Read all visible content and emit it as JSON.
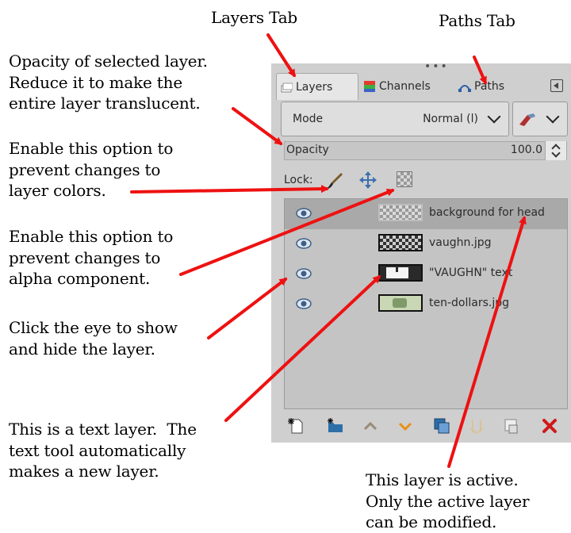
{
  "annotations": {
    "layers_tab": "Layers Tab",
    "paths_tab": "Paths Tab",
    "opacity": "Opacity of selected layer.\nReduce it to make the\nentire layer translucent.",
    "lock_colors": "Enable this option to\nprevent changes to\nlayer colors.",
    "lock_alpha": "Enable this option to\nprevent changes to\nalpha component.",
    "eye": "Click the eye to show\nand hide the layer.",
    "text_layer": "This is a text layer.  The\ntext tool automatically\nmakes a new layer.",
    "active_layer": "This layer is active.\nOnly the active layer\ncan be modified."
  },
  "dock": {
    "tabs": [
      {
        "label": "Layers",
        "icon": "layers-icon"
      },
      {
        "label": "Channels",
        "icon": "channels-icon"
      },
      {
        "label": "Paths",
        "icon": "paths-icon"
      }
    ],
    "mode_label": "Mode",
    "mode_value": "Normal (l)",
    "opacity_label": "Opacity",
    "opacity_value": "100.0",
    "opacity_fraction": 1.0,
    "lock_label": "Lock:",
    "layers": [
      {
        "name": "background for head",
        "active": true
      },
      {
        "name": "vaughn.jpg",
        "active": false
      },
      {
        "name": "\"VAUGHN\" text",
        "active": false
      },
      {
        "name": "ten-dollars.jpg",
        "active": false
      }
    ],
    "bottom_icons": [
      "new-layer-icon",
      "new-layer-group-icon",
      "raise-layer-icon",
      "lower-layer-icon",
      "duplicate-layer-icon",
      "anchor-layer-icon",
      "mask-layer-icon",
      "delete-layer-icon"
    ]
  },
  "colors": {
    "arrow": "#ee1111",
    "delete": "#d01818",
    "eye": "#3c5f8a"
  }
}
